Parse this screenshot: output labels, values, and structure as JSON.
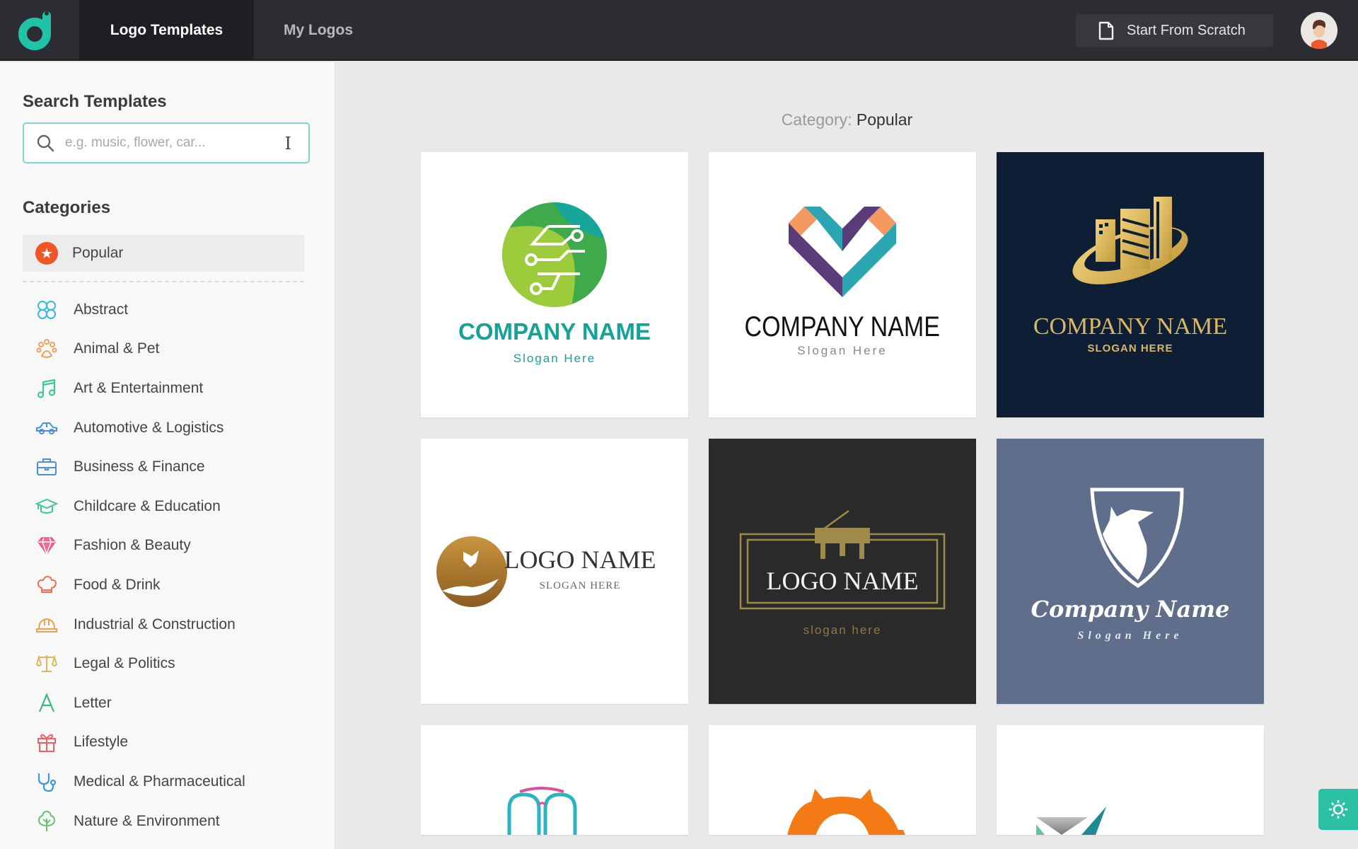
{
  "header": {
    "logo_name": "designevo-logo",
    "tabs": [
      {
        "label": "Logo Templates",
        "active": true
      },
      {
        "label": "My Logos",
        "active": false
      }
    ],
    "start_button_label": "Start From Scratch",
    "accent_color": "#2bbfa4"
  },
  "sidebar": {
    "search_title": "Search Templates",
    "search_placeholder": "e.g. music, flower, car...",
    "search_value": "",
    "categories_title": "Categories",
    "active_category": {
      "label": "Popular",
      "icon": "star-icon",
      "color": "#f05523"
    },
    "categories": [
      {
        "label": "Abstract",
        "icon": "abstract-icon",
        "color": "#39b8e0"
      },
      {
        "label": "Animal & Pet",
        "icon": "paw-icon",
        "color": "#f0a060"
      },
      {
        "label": "Art & Entertainment",
        "icon": "music-note-icon",
        "color": "#3ec89a"
      },
      {
        "label": "Automotive & Logistics",
        "icon": "car-icon",
        "color": "#4a90d9"
      },
      {
        "label": "Business & Finance",
        "icon": "briefcase-icon",
        "color": "#4a90d9"
      },
      {
        "label": "Childcare & Education",
        "icon": "graduation-cap-icon",
        "color": "#3ec89a"
      },
      {
        "label": "Fashion & Beauty",
        "icon": "diamond-icon",
        "color": "#f0507a"
      },
      {
        "label": "Food & Drink",
        "icon": "chef-hat-icon",
        "color": "#f07050"
      },
      {
        "label": "Industrial & Construction",
        "icon": "hard-hat-icon",
        "color": "#f0a050"
      },
      {
        "label": "Legal & Politics",
        "icon": "scales-icon",
        "color": "#d9b860"
      },
      {
        "label": "Letter",
        "icon": "letter-a-icon",
        "color": "#3eb87a"
      },
      {
        "label": "Lifestyle",
        "icon": "gift-icon",
        "color": "#f06060"
      },
      {
        "label": "Medical & Pharmaceutical",
        "icon": "stethoscope-icon",
        "color": "#3a9ad9"
      },
      {
        "label": "Nature & Environment",
        "icon": "tree-icon",
        "color": "#6cc070"
      }
    ]
  },
  "main": {
    "category_prefix": "Category:",
    "category_name": "Popular",
    "templates": [
      {
        "name": "COMPANY NAME",
        "slogan": "Slogan Here",
        "bg": "#ffffff",
        "style": "tech-circle"
      },
      {
        "name": "COMPANY NAME",
        "slogan": "Slogan Here",
        "bg": "#ffffff",
        "style": "heart"
      },
      {
        "name": "COMPANY NAME",
        "slogan": "SLOGAN HERE",
        "bg": "#0e1f35",
        "style": "buildings"
      },
      {
        "name": "LOGO NAME",
        "slogan": "SLOGAN HERE",
        "bg": "#ffffff",
        "style": "dove-hand"
      },
      {
        "name": "LOGO NAME",
        "slogan": "slogan here",
        "bg": "#2a2a2a",
        "style": "piano"
      },
      {
        "name": "Company Name",
        "slogan": "Slogan Here",
        "bg": "#5f6e8b",
        "style": "wolf-shield"
      },
      {
        "name": "",
        "slogan": "",
        "bg": "#ffffff",
        "style": "glasses"
      },
      {
        "name": "",
        "slogan": "",
        "bg": "#ffffff",
        "style": "gear"
      },
      {
        "name": "",
        "slogan": "",
        "bg": "#ffffff",
        "style": "geometric"
      }
    ]
  }
}
